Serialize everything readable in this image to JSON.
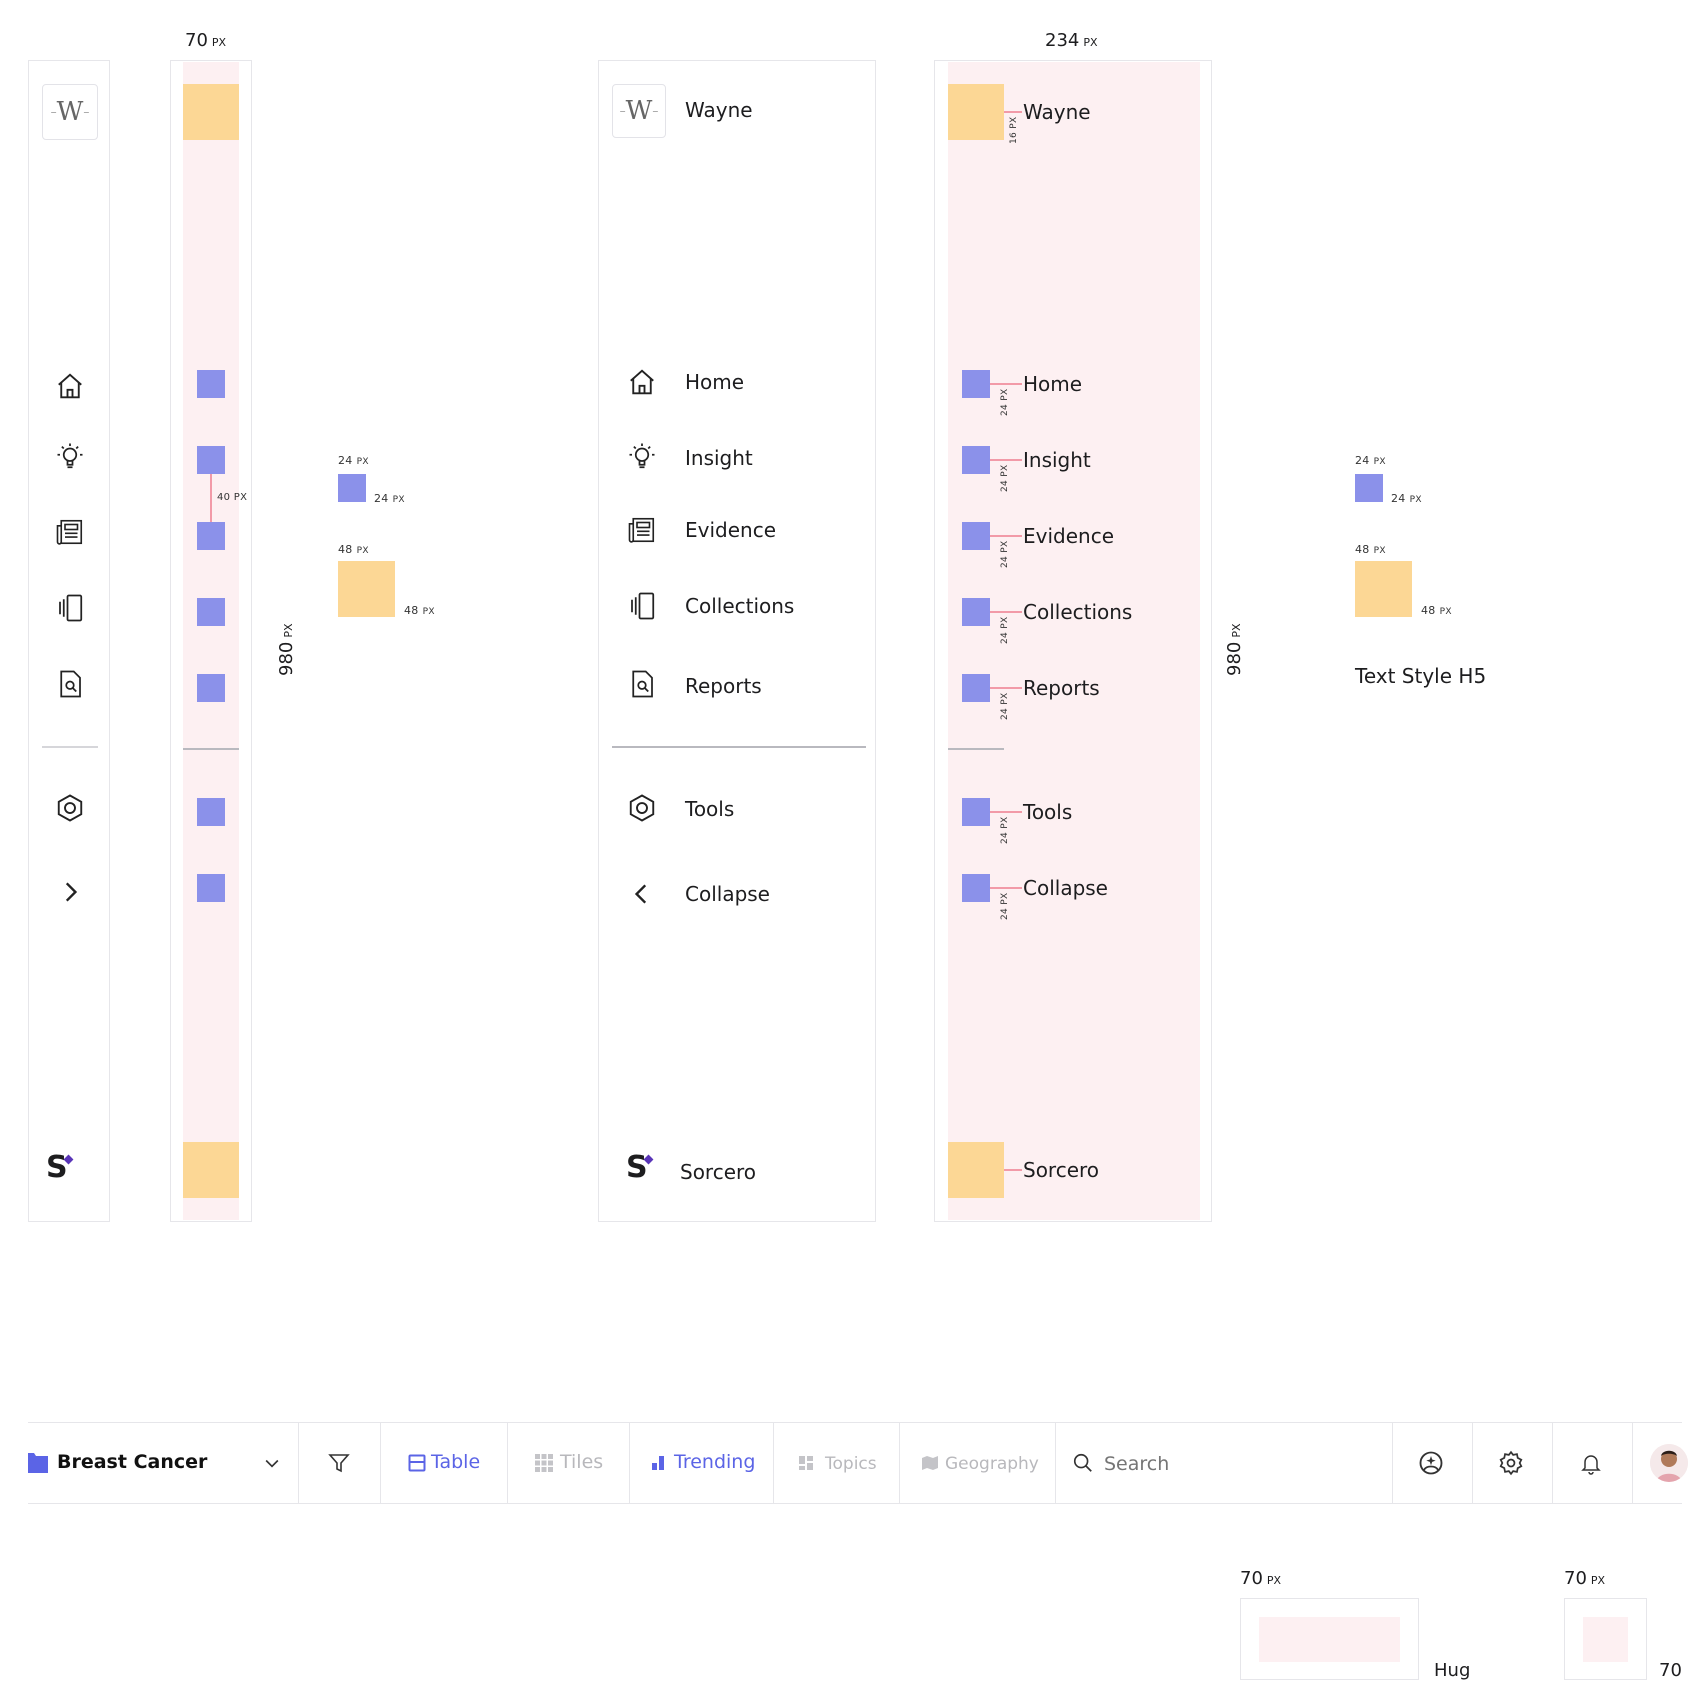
{
  "sidebar": {
    "logo_letter": "W",
    "brand": "Wayne",
    "items": [
      {
        "label": "Home",
        "icon": "home-icon"
      },
      {
        "label": "Insight",
        "icon": "lightbulb-icon"
      },
      {
        "label": "Evidence",
        "icon": "newspaper-icon"
      },
      {
        "label": "Collections",
        "icon": "collections-icon"
      },
      {
        "label": "Reports",
        "icon": "report-search-icon"
      }
    ],
    "tools": {
      "label": "Tools",
      "icon": "hexagon-icon"
    },
    "collapse": {
      "label": "Collapse",
      "icon": "chevron-left-icon"
    },
    "expand_icon": "chevron-right-icon",
    "footer": "Sorcero",
    "footer_logo": "S"
  },
  "specs": {
    "collapsed_width": "70",
    "expanded_width": "234",
    "height": "980",
    "px": "PX",
    "gap_40": "40 PX",
    "gap_16": "16 PX",
    "gap_24": "24 PX",
    "icon_size": "24",
    "logo_size": "48",
    "text_style": "Text Style H5",
    "hug": "Hug",
    "seventy": "70"
  },
  "toolbar": {
    "project": "Breast Cancer",
    "tabs": {
      "table": "Table",
      "tiles": "Tiles",
      "trending": "Trending",
      "topics": "Topics",
      "geography": "Geography"
    },
    "search_placeholder": "Search"
  },
  "colors": {
    "accent": "#5b64e6",
    "spacer_yellow": "#fcd795",
    "icon_blue": "#8b91ea",
    "guide_pink": "#f29aa8",
    "column_pink": "#fdf0f2"
  }
}
